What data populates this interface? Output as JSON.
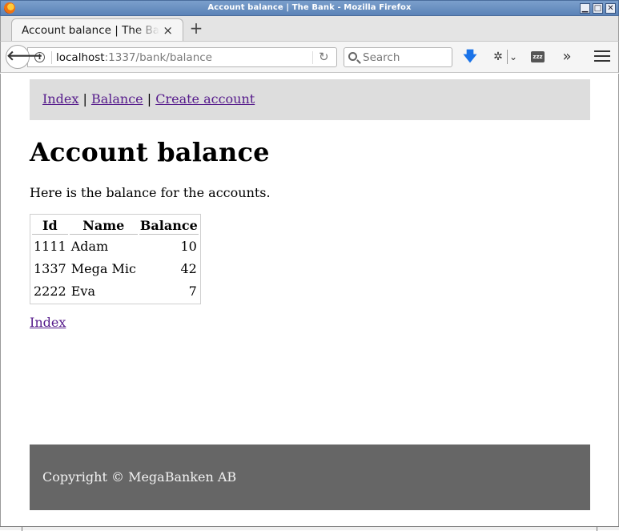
{
  "window": {
    "title": "Account balance | The Bank - Mozilla Firefox",
    "minimize_glyph": "▁",
    "maximize_glyph": "□",
    "close_glyph": "✕"
  },
  "tabs": [
    {
      "label": "Account balance | The Bank",
      "close_glyph": "×"
    }
  ],
  "new_tab_glyph": "+",
  "toolbar": {
    "back_glyph": "🡐",
    "url_host": "localhost",
    "url_rest": ":1337/bank/balance",
    "reload_glyph": "↻",
    "search_placeholder": "Search",
    "download_glyph": "🡇",
    "overflow_glyph": "»",
    "zzz_label": "zzz"
  },
  "site_nav": {
    "links": [
      "Index",
      "Balance",
      "Create account"
    ],
    "separator": "|"
  },
  "page": {
    "heading": "Account balance",
    "intro": "Here is the balance for the accounts.",
    "bottom_link": "Index"
  },
  "table": {
    "headers": [
      "Id",
      "Name",
      "Balance"
    ],
    "rows": [
      [
        "1111",
        "Adam",
        "10"
      ],
      [
        "1337",
        "Mega Mic",
        "42"
      ],
      [
        "2222",
        "Eva",
        "7"
      ]
    ]
  },
  "footer": {
    "text": "Copyright © MegaBanken AB"
  },
  "colors": {
    "link": "#551a8b",
    "nav_bg": "#dddddd",
    "footer_bg": "#666666",
    "titlebar": "#5b83b7"
  }
}
